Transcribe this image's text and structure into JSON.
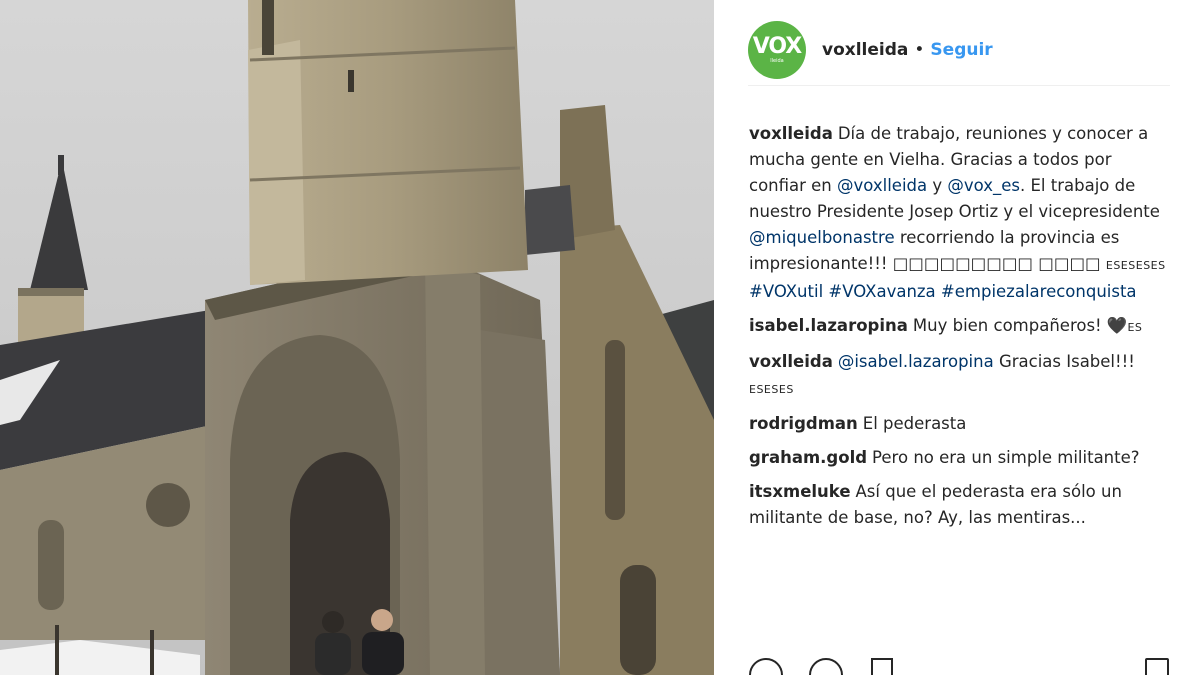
{
  "post": {
    "username": "voxlleida",
    "separator": "•",
    "follow_label": "Seguir",
    "avatar": {
      "brand": "VOX",
      "sub": "lleida",
      "color": "#5bb446"
    }
  },
  "caption": {
    "user": "voxlleida",
    "text_1": "Día de trabajo, reuniones y conocer a mucha gente en Vielha. Gracias a todos por confiar en ",
    "mention_1": "@voxlleida",
    "text_2": " y ",
    "mention_2": "@vox_es",
    "text_3": ". El trabajo de nuestro Presidente Josep Ortiz y el vicepresidente ",
    "mention_3": "@miquelbonastre",
    "text_4": " recorriendo la provincia es impresionante!!! □□□□□□□□□ □□□□ ",
    "flags": "ESESESES",
    "hashtags": " #VOXutil #VOXavanza #empiezalareconquista"
  },
  "comments": [
    {
      "user": "isabel.lazaropina",
      "text": "Muy bien compañeros! 🖤",
      "suffix": "ES"
    },
    {
      "user": "voxlleida",
      "mention": "@isabel.lazaropina",
      "text": " Gracias Isabel!!! ",
      "suffix": "ESESES"
    },
    {
      "user": "rodrigdman",
      "text": "El pederasta"
    },
    {
      "user": "graham.gold",
      "text": "Pero no era un simple militante?"
    },
    {
      "user": "itsxmeluke",
      "text": "Así que el pederasta era sólo un militante de base, no? Ay, las mentiras..."
    }
  ],
  "icons": [
    "heart-icon",
    "comment-icon",
    "share-icon",
    "bookmark-icon"
  ],
  "colors": {
    "link": "#3897f0",
    "mention": "#003569",
    "text": "#262626"
  }
}
